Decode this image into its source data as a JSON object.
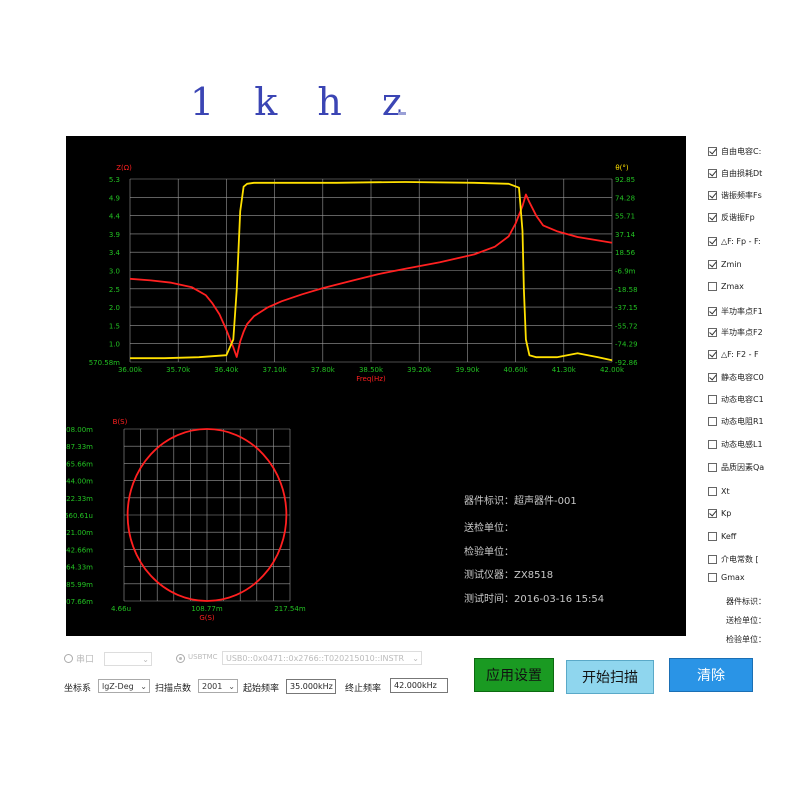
{
  "title": {
    "text": "1 k h z"
  },
  "colors": {
    "impedance": "#ff2020",
    "phase": "#ffe000",
    "admittance": "#ff2020",
    "axis_green": "#22c022",
    "grid": "#9a9a9a",
    "apply": "#1a9a22",
    "scan": "#8fd6ee",
    "clear": "#2a94e6"
  },
  "chart_data": [
    {
      "type": "line",
      "left_title": "Z(Ω)",
      "right_title": "θ(°)",
      "xlabel": "Freq(Hz)",
      "left_ticks": [
        "5.3",
        "4.9",
        "4.4",
        "3.9",
        "3.4",
        "3.0",
        "2.5",
        "2.0",
        "1.5",
        "1.0",
        "570.58m"
      ],
      "right_ticks": [
        "92.85",
        "74.28",
        "55.71",
        "37.14",
        "18.56",
        "-6.9m",
        "-18.58",
        "-37.15",
        "-55.72",
        "-74.29",
        "-92.86"
      ],
      "x_ticks": [
        "36.00k",
        "35.70k",
        "36.40k",
        "37.10k",
        "37.80k",
        "38.50k",
        "39.20k",
        "39.90k",
        "40.60k",
        "41.30k",
        "42.00k"
      ],
      "xlim": [
        35000,
        42000
      ],
      "ylim_left": [
        0.57,
        5.3
      ],
      "ylim_right": [
        -92.86,
        92.85
      ],
      "series": [
        {
          "axis": "left",
          "color": "#ff2020",
          "x": [
            35000,
            35300,
            35600,
            35900,
            36100,
            36200,
            36300,
            36400,
            36500,
            36550,
            36600,
            36650,
            36700,
            36800,
            37000,
            37200,
            37500,
            37800,
            38200,
            38600,
            39000,
            39500,
            40000,
            40300,
            40500,
            40600,
            40700,
            40750,
            40800,
            40900,
            41000,
            41200,
            41500,
            42000
          ],
          "y": [
            2.72,
            2.68,
            2.62,
            2.5,
            2.3,
            2.08,
            1.8,
            1.4,
            0.95,
            0.7,
            1.1,
            1.35,
            1.55,
            1.75,
            1.98,
            2.14,
            2.32,
            2.48,
            2.66,
            2.84,
            2.98,
            3.15,
            3.35,
            3.55,
            3.82,
            4.15,
            4.6,
            4.9,
            4.7,
            4.35,
            4.1,
            3.95,
            3.8,
            3.65
          ]
        },
        {
          "axis": "right",
          "color": "#ffe000",
          "x": [
            35000,
            35500,
            36000,
            36400,
            36500,
            36550,
            36600,
            36650,
            36700,
            36800,
            37200,
            38000,
            38500,
            39000,
            40000,
            40500,
            40650,
            40700,
            40720,
            40750,
            40800,
            40900,
            41200,
            41500,
            41800,
            42000
          ],
          "y": [
            -89,
            -89,
            -88,
            -86,
            -70,
            -20,
            60,
            85,
            88,
            89,
            89,
            89,
            89.5,
            89.8,
            89,
            88,
            84,
            40,
            -20,
            -70,
            -86,
            -88,
            -88,
            -84,
            -88,
            -91
          ]
        }
      ]
    },
    {
      "type": "scatter",
      "left_title": "B(S)",
      "xlabel": "G(S)",
      "left_ticks": [
        "108.00m",
        "87.33m",
        "65.66m",
        "44.00m",
        "22.33m",
        "660.61u",
        "-21.00m",
        "-42.66m",
        "-64.33m",
        "-85.99m",
        "-107.66m"
      ],
      "x_ticks": [
        "4.66u",
        "108.77m",
        "217.54m"
      ],
      "xlim": [
        0,
        217.54
      ],
      "ylim": [
        -107.66,
        108.0
      ],
      "series": [
        {
          "color": "#ff2020",
          "shape": "circle",
          "center": [
            108.77,
            0.17
          ],
          "radius": 107.8
        }
      ]
    }
  ],
  "info": {
    "device_id": "器件标识：超声器件-001",
    "send_unit": "送检单位：",
    "check_unit": "检验单位：",
    "instrument": "测试仪器：ZX8518",
    "test_time": "测试时间：2016-03-16 15:54"
  },
  "side_checkboxes": [
    {
      "label": "自由电容C:",
      "checked": true
    },
    {
      "label": "自由损耗Dt",
      "checked": true
    },
    {
      "label": "谐振频率Fs",
      "checked": true
    },
    {
      "label": "反谐振Fp",
      "checked": true
    },
    {
      "label": "△F: Fp - F:",
      "checked": true
    },
    {
      "label": "Zmin",
      "checked": true
    },
    {
      "label": "Zmax",
      "checked": false
    },
    {
      "label": "半功率点F1",
      "checked": true
    },
    {
      "label": "半功率点F2",
      "checked": true
    },
    {
      "label": "△F: F2 - F",
      "checked": true
    },
    {
      "label": "静态电容C0",
      "checked": true
    },
    {
      "label": "动态电容C1",
      "checked": false
    },
    {
      "label": "动态电阻R1",
      "checked": false
    },
    {
      "label": "动态电感L1",
      "checked": false
    },
    {
      "label": "品质因素Qa",
      "checked": false
    },
    {
      "label": "Xt",
      "checked": false
    },
    {
      "label": "Kp",
      "checked": true
    },
    {
      "label": "Keff",
      "checked": false
    },
    {
      "label": "介电常数 [",
      "checked": false
    },
    {
      "label": "Gmax",
      "checked": false
    }
  ],
  "side_texts": [
    "器件标识：",
    "送检单位：",
    "检验单位："
  ],
  "connection": {
    "serial_label": "串口",
    "usbtmc_label": "USBTMC",
    "usbtmc_value": "USB0::0x0471::0x2766::T020215010::INSTR"
  },
  "controls": {
    "coord_label": "坐标系",
    "coord_value": "lgZ-Deg",
    "points_label": "扫描点数",
    "points_value": "2001",
    "start_label": "起始频率",
    "start_value": "35.000kHz",
    "stop_label": "终止频率",
    "stop_value": "42.000kHz"
  },
  "buttons": {
    "apply": "应用设置",
    "scan": "开始扫描",
    "clear": "清除"
  }
}
